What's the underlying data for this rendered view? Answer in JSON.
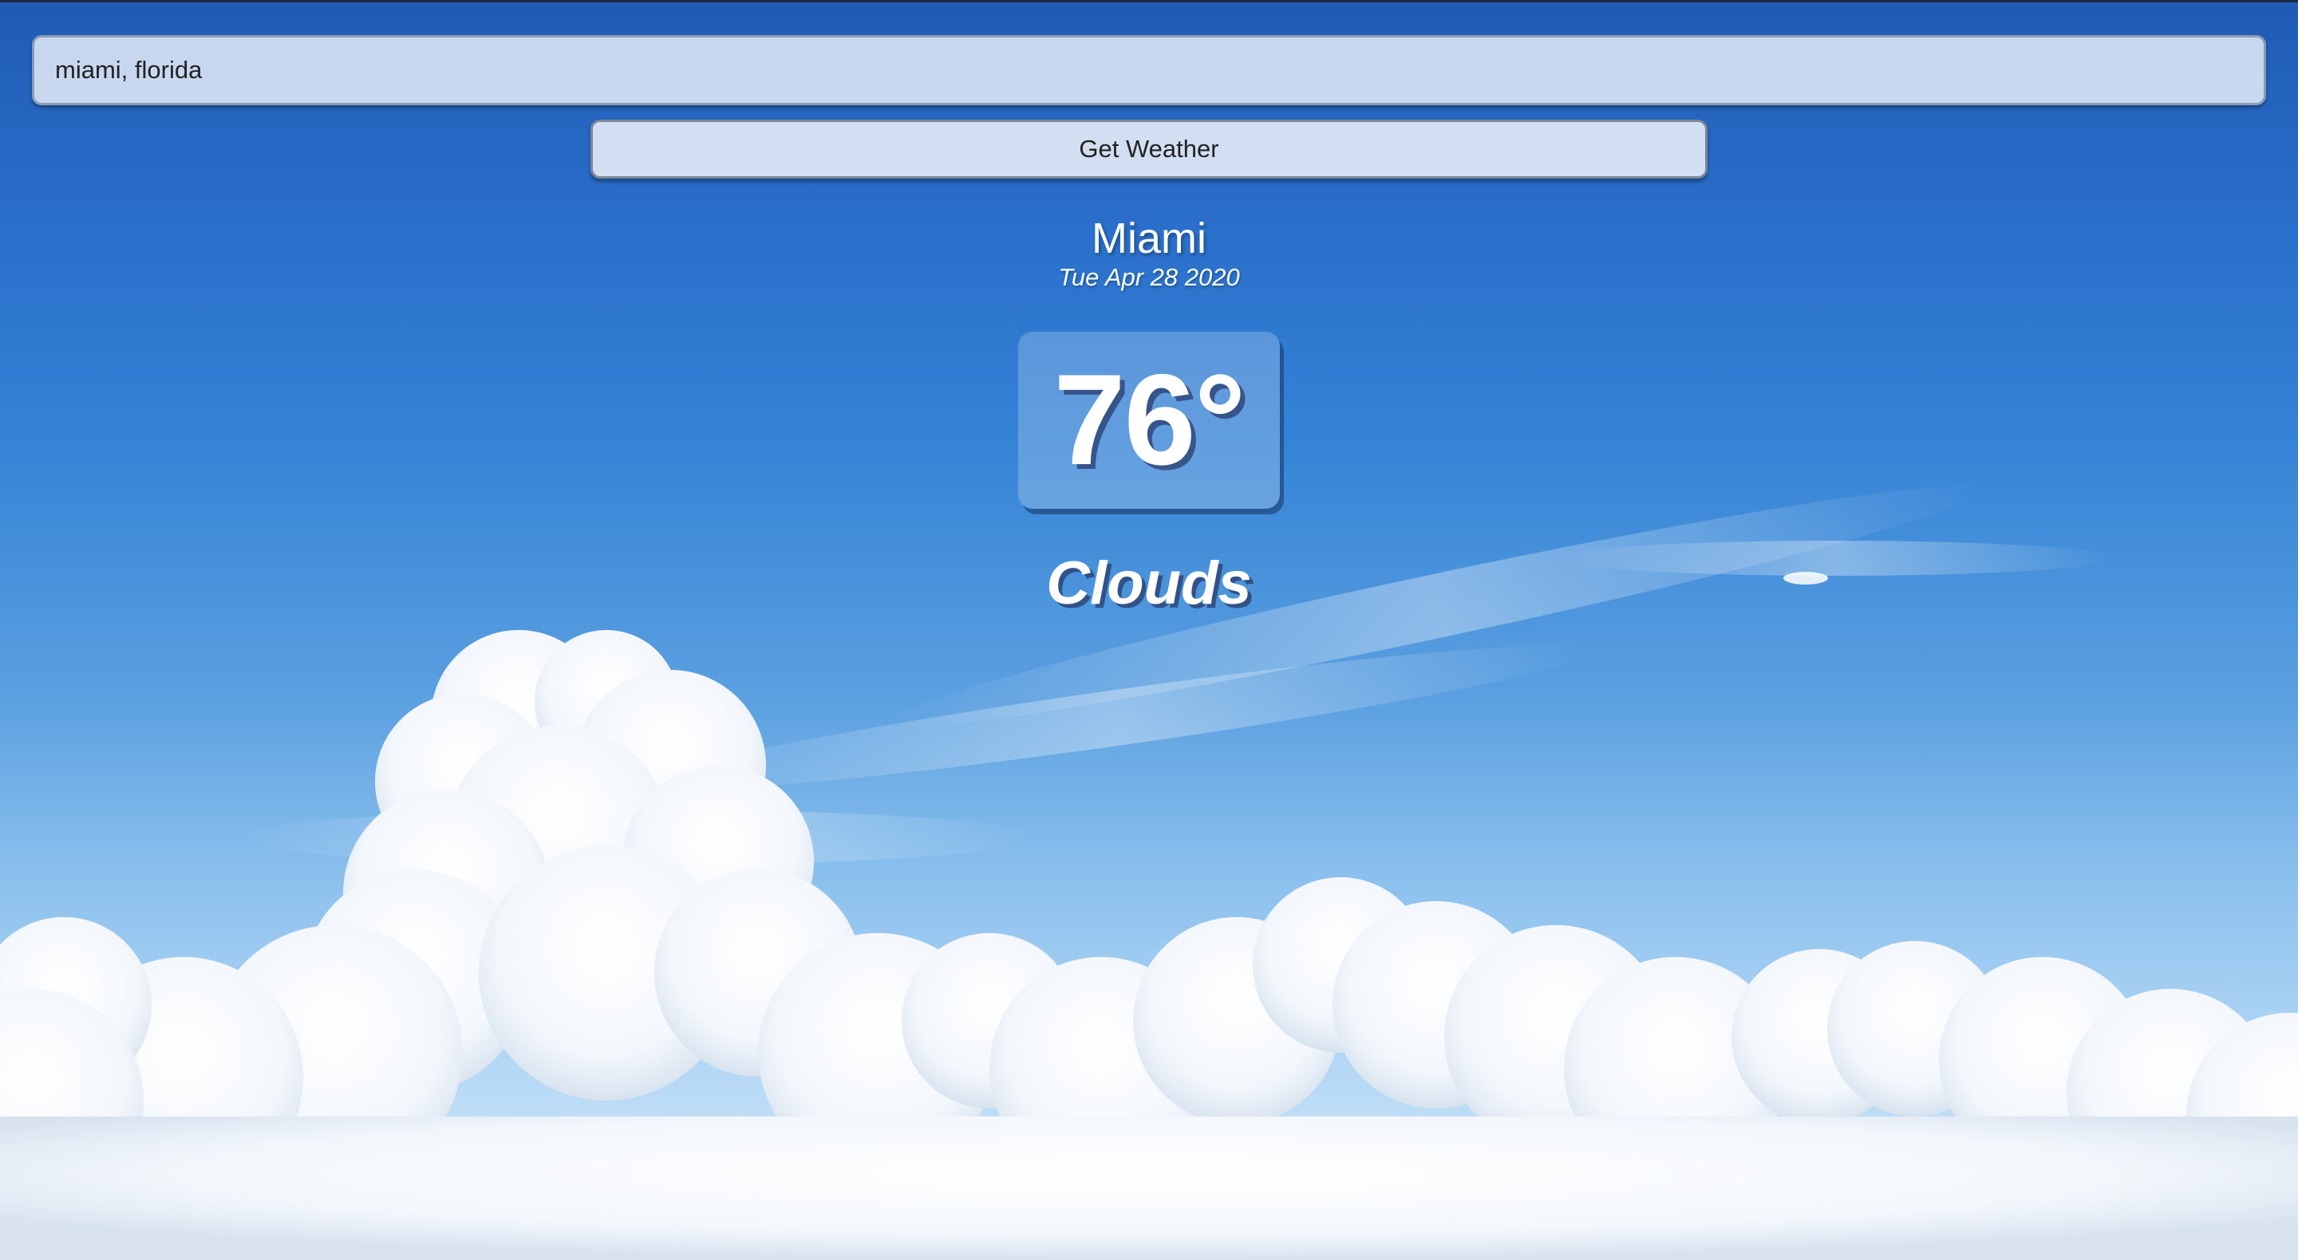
{
  "search": {
    "value": "miami, florida"
  },
  "actions": {
    "get_weather_label": "Get Weather"
  },
  "weather": {
    "city": "Miami",
    "date": "Tue Apr 28 2020",
    "temperature": "76°",
    "condition": "Clouds"
  },
  "colors": {
    "sky_top": "#1f5bb5",
    "sky_bottom": "#d9ecfb",
    "text": "#ffffff"
  }
}
